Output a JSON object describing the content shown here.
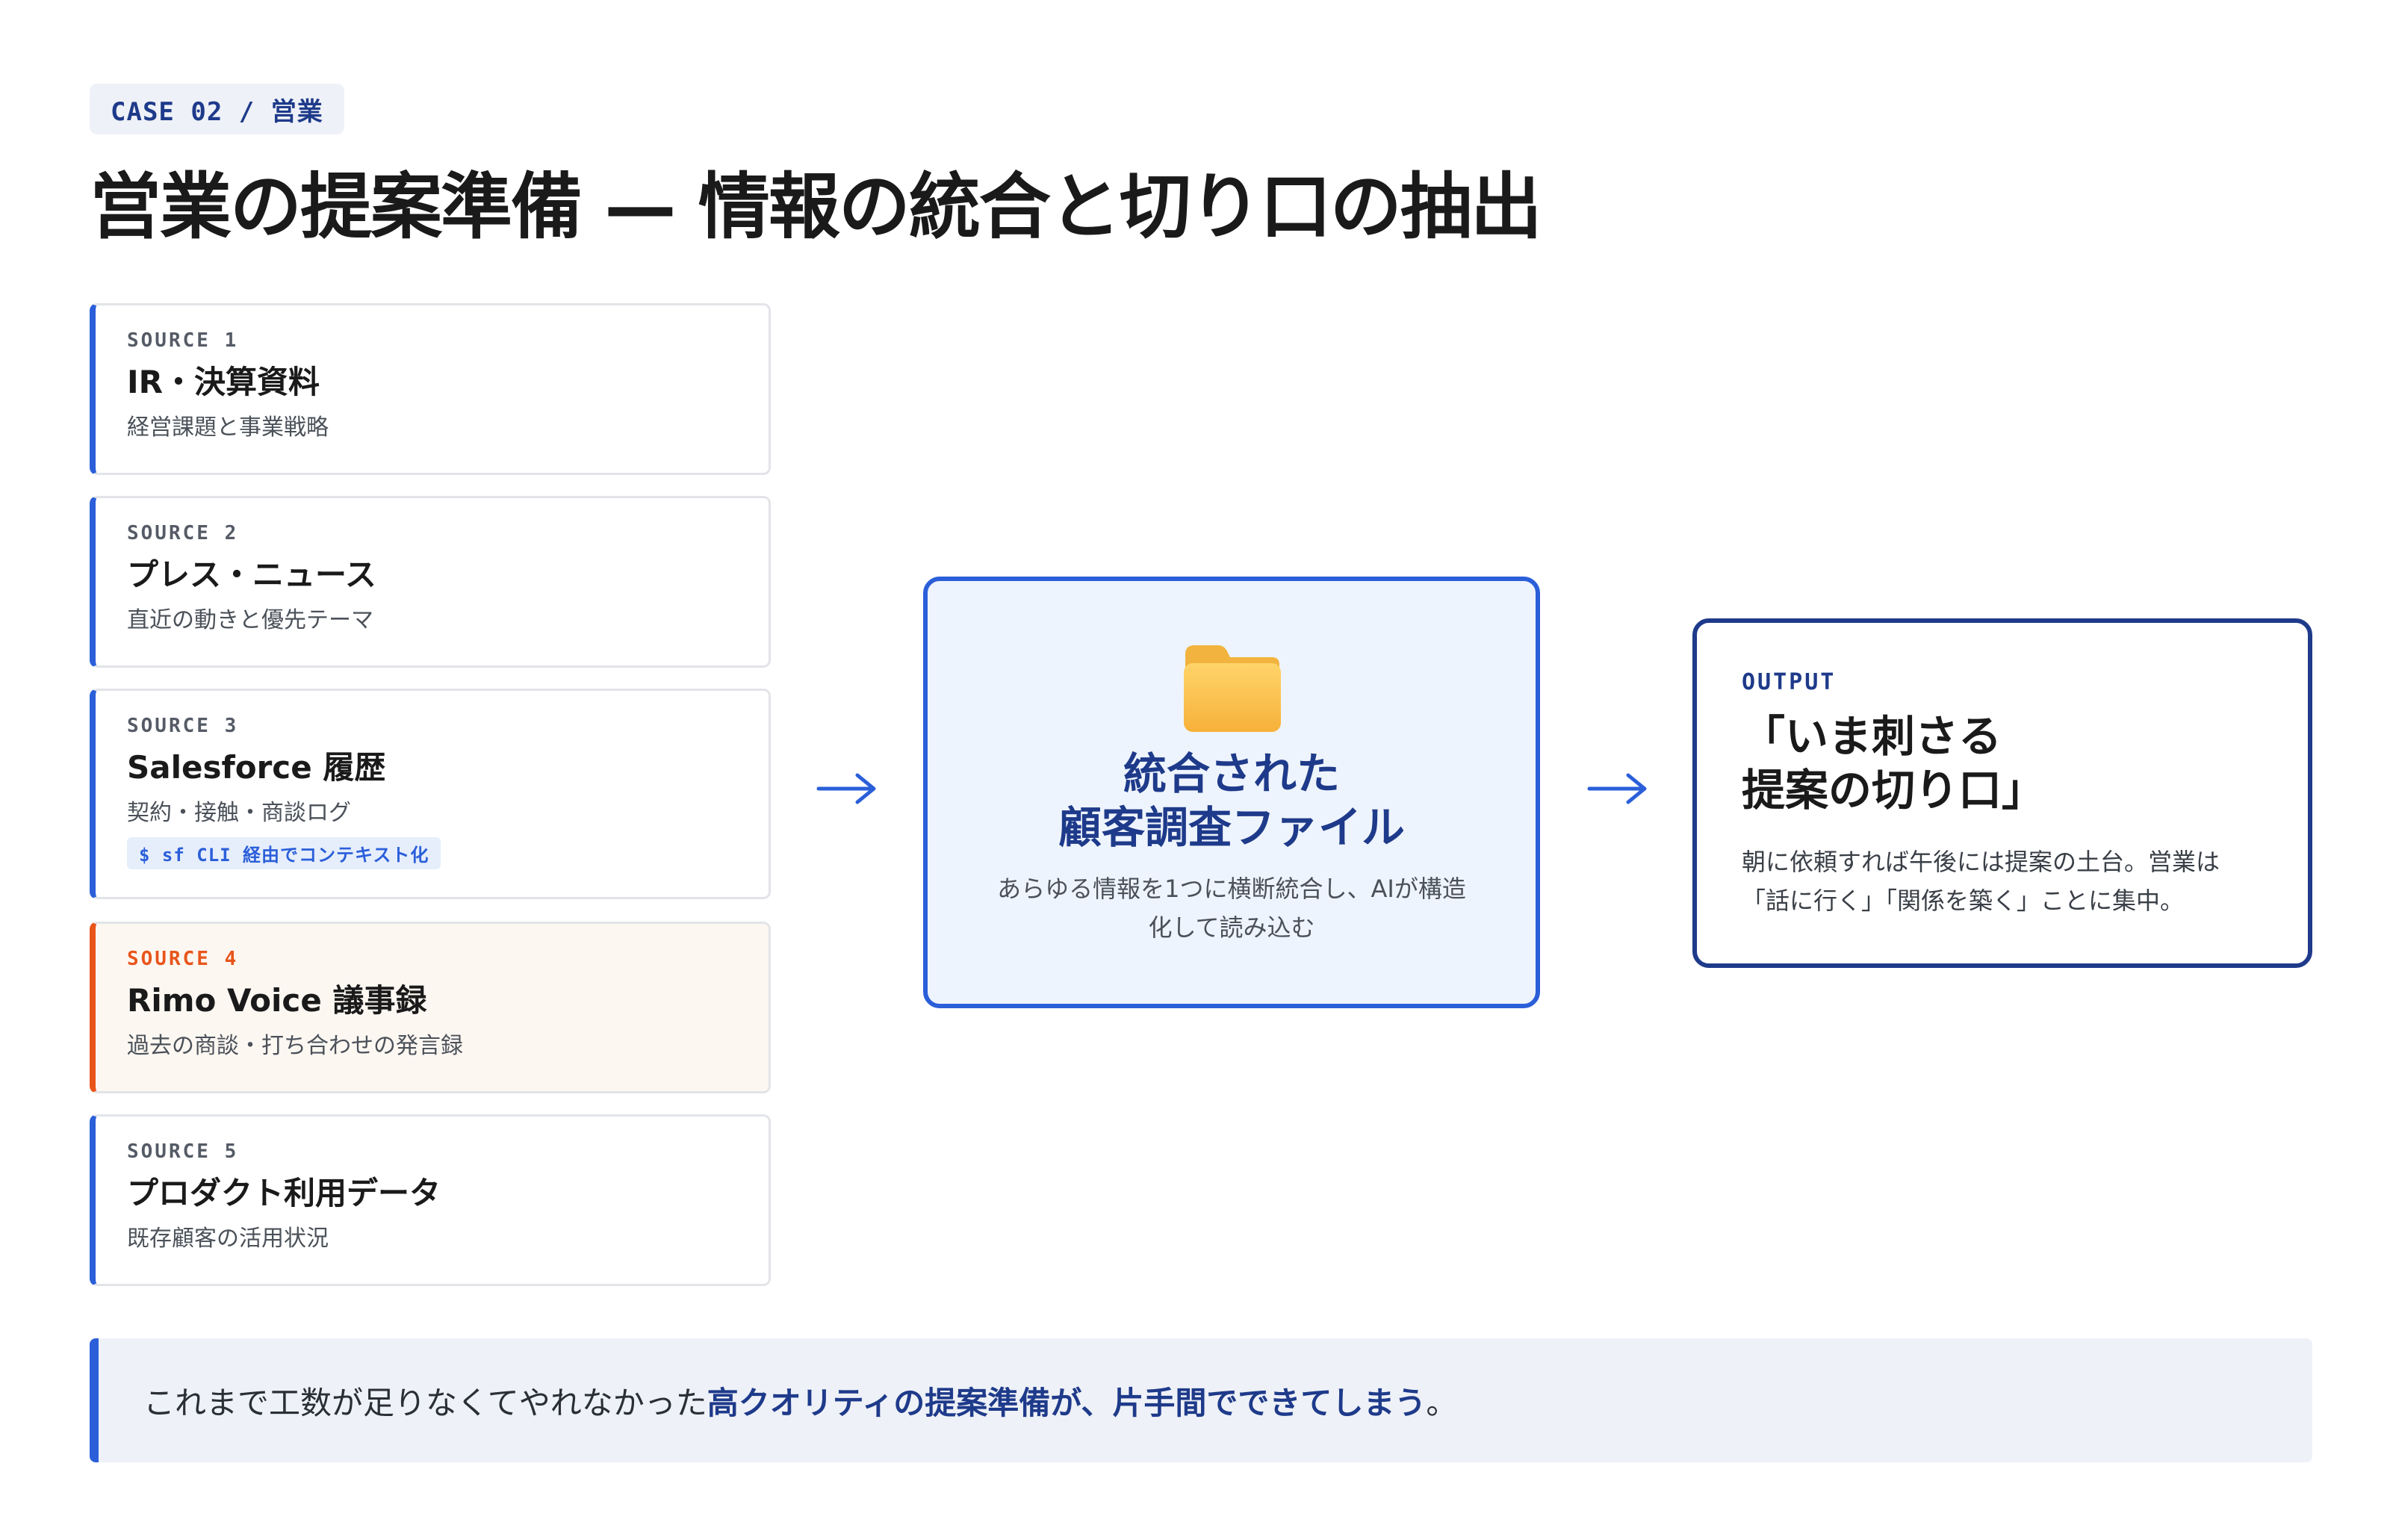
{
  "tag": "CASE 02 / 営業",
  "title": "営業の提案準備 — 情報の統合と切り口の抽出",
  "sources": [
    {
      "label": "SOURCE 1",
      "title": "IR・決算資料",
      "desc": "経営課題と事業戦略",
      "code": null,
      "highlight": false
    },
    {
      "label": "SOURCE 2",
      "title": "プレス・ニュース",
      "desc": "直近の動きと優先テーマ",
      "code": null,
      "highlight": false
    },
    {
      "label": "SOURCE 3",
      "title": "Salesforce 履歴",
      "desc": "契約・接触・商談ログ",
      "code": "$ sf CLI 経由でコンテキスト化",
      "highlight": false
    },
    {
      "label": "SOURCE 4",
      "title": "Rimo Voice 議事録",
      "desc": "過去の商談・打ち合わせの発言録",
      "code": null,
      "highlight": true
    },
    {
      "label": "SOURCE 5",
      "title": "プロダクト利用データ",
      "desc": "既存顧客の活用状況",
      "code": null,
      "highlight": false
    }
  ],
  "center": {
    "icon": "folder-icon",
    "title_line1": "統合された",
    "title_line2": "顧客調査ファイル",
    "desc_line1": "あらゆる情報を1つに横断統合し、AIが構造",
    "desc_line2": "化して読み込む"
  },
  "output": {
    "label": "OUTPUT",
    "title_line1": "「いま刺さる",
    "title_line2": "提案の切り口」",
    "desc_line1": "朝に依頼すれば午後には提案の土台。営業は",
    "desc_line2": "「話に行く」「関係を築く」ことに集中。"
  },
  "bottom": {
    "plain": "これまで工数が足りなくてやれなかった",
    "emphasis": "高クオリティの提案準備が、片手間でできてしまう",
    "end": "。"
  },
  "colors": {
    "accent_blue": "#2b5fd9",
    "navy": "#1e3a8a",
    "highlight_orange": "#e8551b"
  }
}
